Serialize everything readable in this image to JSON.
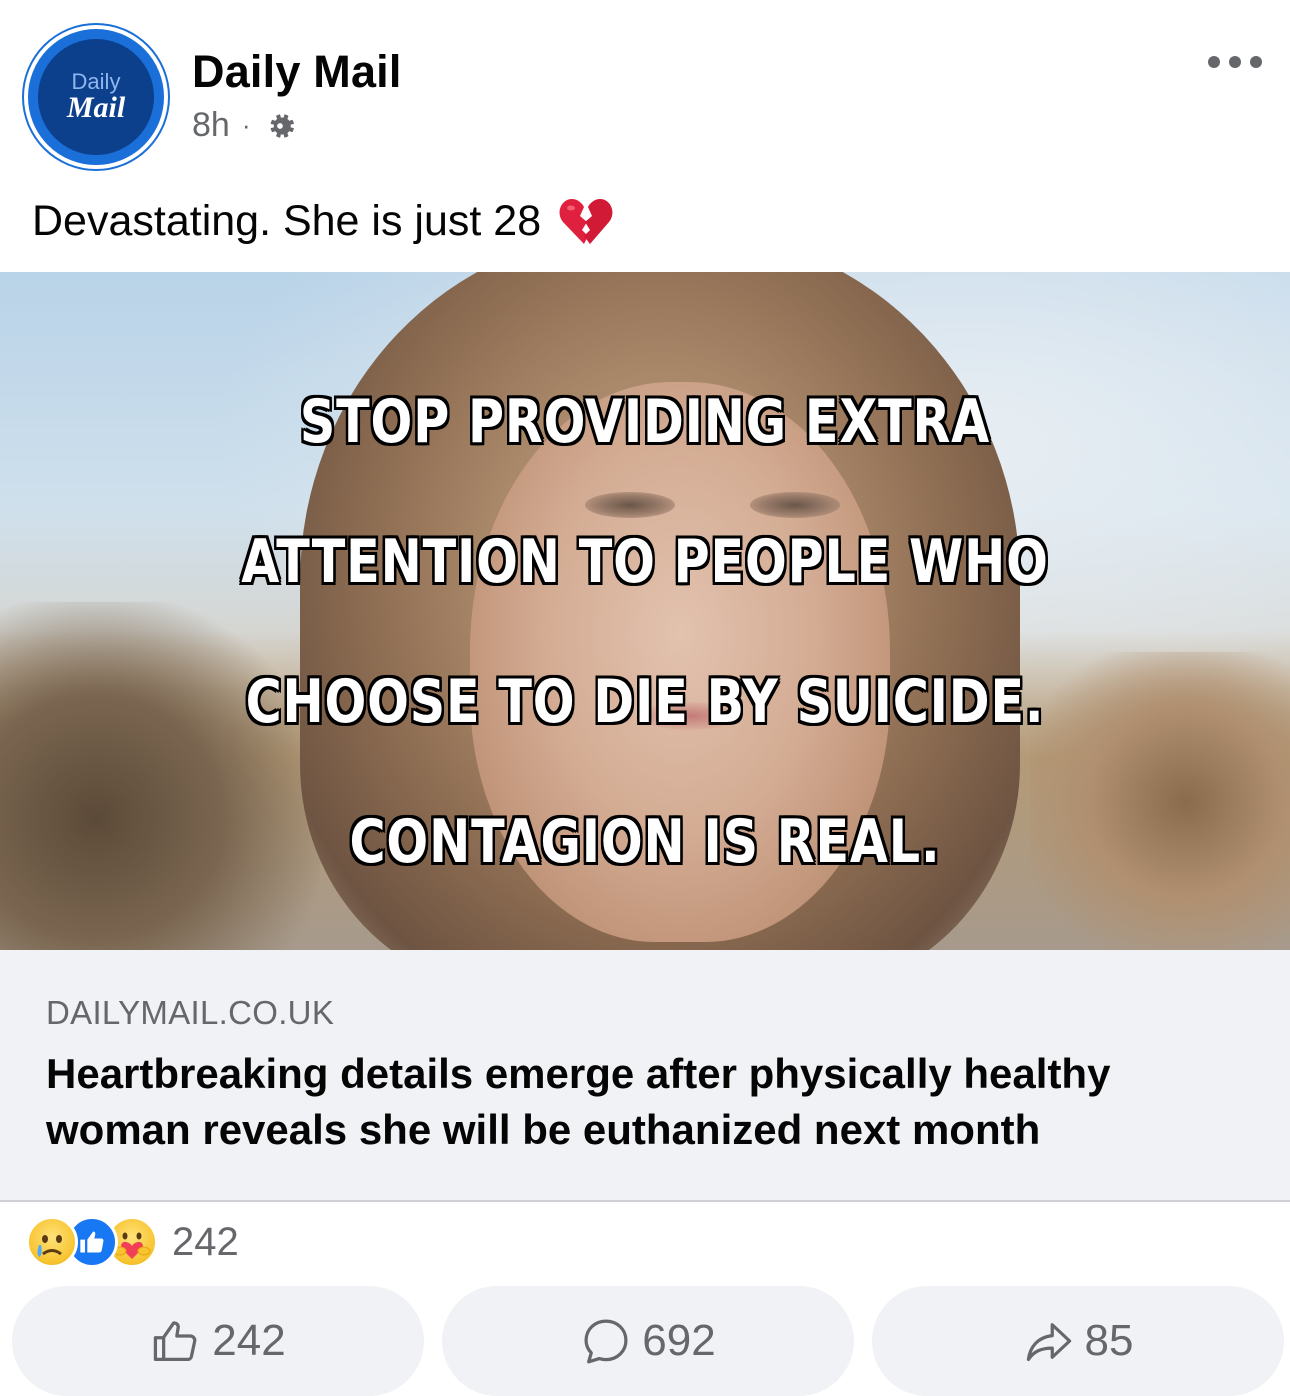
{
  "post": {
    "page_name": "Daily Mail",
    "avatar": {
      "line1": "Daily",
      "line2": "Mail"
    },
    "timestamp": "8h",
    "separator": "·",
    "audience_icon": "gear-icon",
    "caption": "Devastating. She is just 28",
    "caption_emoji": "broken-heart-icon"
  },
  "image": {
    "overlay_lines": [
      "STOP PROVIDING EXTRA",
      "ATTENTION TO PEOPLE WHO",
      "CHOOSE TO DIE BY SUICIDE.",
      "CONTAGION IS REAL."
    ]
  },
  "link": {
    "domain": "DAILYMAIL.CO.UK",
    "title": "Heartbreaking details emerge after physically healthy woman reveals she will be euthanized next month"
  },
  "reactions": {
    "icons": [
      "sad-reaction-icon",
      "like-reaction-icon",
      "care-reaction-icon"
    ],
    "count": "242"
  },
  "actions": {
    "like_count": "242",
    "comment_count": "692",
    "share_count": "85"
  },
  "colors": {
    "brand_blue": "#1a6fd8",
    "text_primary": "#050505",
    "text_secondary": "#65676b",
    "card_bg": "#f0f2f5",
    "like_blue": "#1877f2"
  }
}
